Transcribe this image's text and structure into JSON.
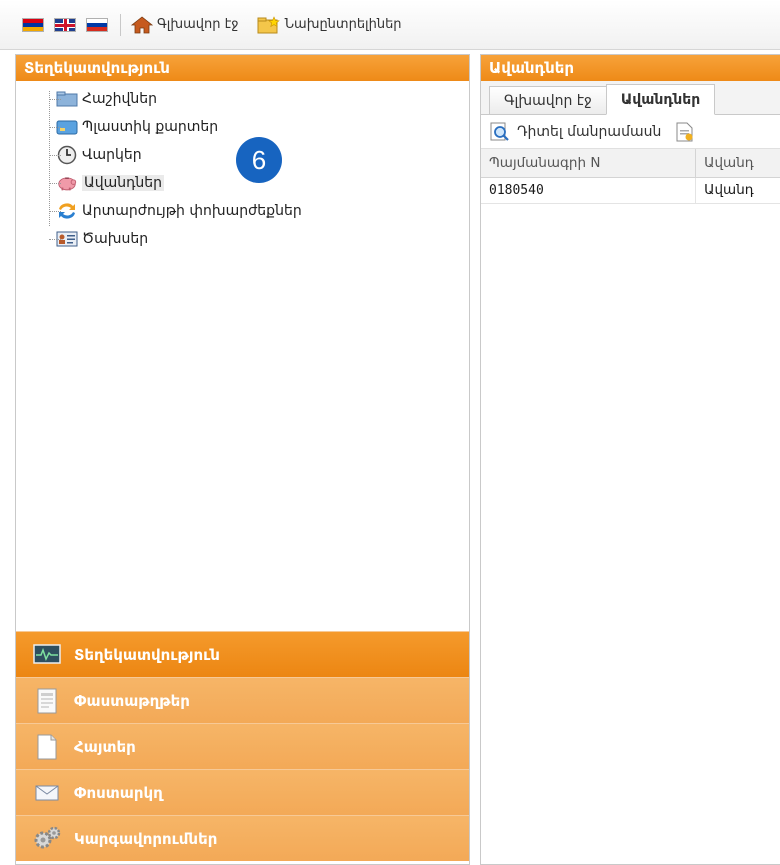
{
  "toolbar": {
    "flags": [
      "flag-armenia-icon",
      "flag-uk-icon",
      "flag-russia-icon"
    ],
    "home_label": "Գլխավոր էջ",
    "favorites_label": "Նախընտրելիներ"
  },
  "left_panel": {
    "title": "Տեղեկատվություն",
    "tree": [
      {
        "label": "Հաշիվներ",
        "icon": "folder-icon"
      },
      {
        "label": "Պլաստիկ քարտեր",
        "icon": "card-icon"
      },
      {
        "label": "Վարկեր",
        "icon": "clock-icon"
      },
      {
        "label": "Ավանդներ",
        "icon": "piggy-bank-icon",
        "selected": true
      },
      {
        "label": "Արտարժույթի փոխարժեքներ",
        "icon": "exchange-icon"
      },
      {
        "label": "Ծախսեր",
        "icon": "contact-card-icon"
      }
    ],
    "callout_number": "6"
  },
  "accordion": [
    {
      "label": "Տեղեկատվություն",
      "icon": "monitor-icon",
      "active": true
    },
    {
      "label": "Փաստաթղթեր",
      "icon": "document-icon",
      "active": false
    },
    {
      "label": "Հայտեր",
      "icon": "page-icon",
      "active": false
    },
    {
      "label": "Փոստարկղ",
      "icon": "envelope-icon",
      "active": false
    },
    {
      "label": "Կարգավորումներ",
      "icon": "gears-icon",
      "active": false
    }
  ],
  "right_panel": {
    "title": "Ավանդներ",
    "tabs": [
      "Գլխավոր էջ",
      "Ավանդներ"
    ],
    "actions": [
      "Դիտել մանրամասն"
    ],
    "table": {
      "columns": [
        "Պայմանագրի N",
        "Ավանդ"
      ],
      "rows": [
        [
          "0180540",
          "Ավանդ"
        ]
      ]
    }
  },
  "colors": {
    "accent": "#ee8a17",
    "accent_light": "#f3a957",
    "callout": "#1764c0"
  }
}
